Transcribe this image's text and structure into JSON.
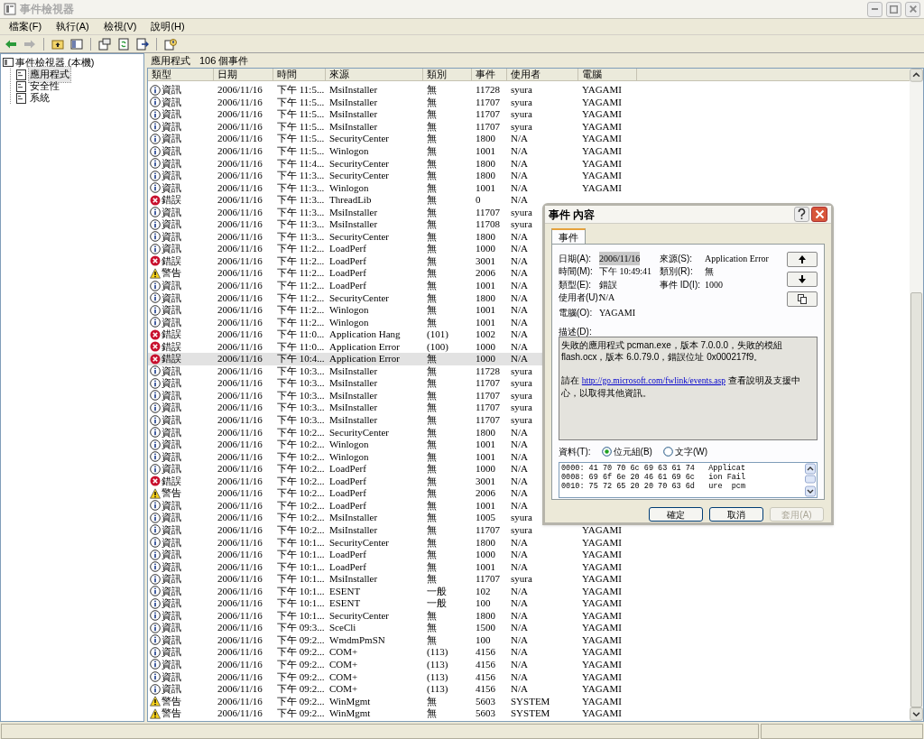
{
  "window": {
    "title": "事件檢視器"
  },
  "menu": [
    "檔案(F)",
    "執行(A)",
    "檢視(V)",
    "說明(H)"
  ],
  "tree": {
    "root": "事件檢視器 (本機)",
    "children": [
      {
        "label": "應用程式",
        "selected": true
      },
      {
        "label": "安全性",
        "selected": false
      },
      {
        "label": "系統",
        "selected": false
      }
    ]
  },
  "list": {
    "title": "應用程式",
    "count": "106 個事件",
    "columns": [
      "類型",
      "日期",
      "時間",
      "來源",
      "類別",
      "事件",
      "使用者",
      "電腦"
    ],
    "rows": [
      {
        "kind": "info",
        "type": "資訊",
        "date": "2006/11/16",
        "time": "下午 11:5...",
        "source": "MsiInstaller",
        "category": "無",
        "event": "11728",
        "user": "syura",
        "computer": "YAGAMI",
        "selected": false
      },
      {
        "kind": "info",
        "type": "資訊",
        "date": "2006/11/16",
        "time": "下午 11:5...",
        "source": "MsiInstaller",
        "category": "無",
        "event": "11707",
        "user": "syura",
        "computer": "YAGAMI",
        "selected": false
      },
      {
        "kind": "info",
        "type": "資訊",
        "date": "2006/11/16",
        "time": "下午 11:5...",
        "source": "MsiInstaller",
        "category": "無",
        "event": "11707",
        "user": "syura",
        "computer": "YAGAMI",
        "selected": false
      },
      {
        "kind": "info",
        "type": "資訊",
        "date": "2006/11/16",
        "time": "下午 11:5...",
        "source": "MsiInstaller",
        "category": "無",
        "event": "11707",
        "user": "syura",
        "computer": "YAGAMI",
        "selected": false
      },
      {
        "kind": "info",
        "type": "資訊",
        "date": "2006/11/16",
        "time": "下午 11:5...",
        "source": "SecurityCenter",
        "category": "無",
        "event": "1800",
        "user": "N/A",
        "computer": "YAGAMI",
        "selected": false
      },
      {
        "kind": "info",
        "type": "資訊",
        "date": "2006/11/16",
        "time": "下午 11:5...",
        "source": "Winlogon",
        "category": "無",
        "event": "1001",
        "user": "N/A",
        "computer": "YAGAMI",
        "selected": false
      },
      {
        "kind": "info",
        "type": "資訊",
        "date": "2006/11/16",
        "time": "下午 11:4...",
        "source": "SecurityCenter",
        "category": "無",
        "event": "1800",
        "user": "N/A",
        "computer": "YAGAMI",
        "selected": false
      },
      {
        "kind": "info",
        "type": "資訊",
        "date": "2006/11/16",
        "time": "下午 11:3...",
        "source": "SecurityCenter",
        "category": "無",
        "event": "1800",
        "user": "N/A",
        "computer": "YAGAMI",
        "selected": false
      },
      {
        "kind": "info",
        "type": "資訊",
        "date": "2006/11/16",
        "time": "下午 11:3...",
        "source": "Winlogon",
        "category": "無",
        "event": "1001",
        "user": "N/A",
        "computer": "YAGAMI",
        "selected": false
      },
      {
        "kind": "error",
        "type": "錯誤",
        "date": "2006/11/16",
        "time": "下午 11:3...",
        "source": "ThreadLib",
        "category": "無",
        "event": "0",
        "user": "N/A",
        "selected": false
      },
      {
        "kind": "info",
        "type": "資訊",
        "date": "2006/11/16",
        "time": "下午 11:3...",
        "source": "MsiInstaller",
        "category": "無",
        "event": "11707",
        "user": "syura",
        "selected": false
      },
      {
        "kind": "info",
        "type": "資訊",
        "date": "2006/11/16",
        "time": "下午 11:3...",
        "source": "MsiInstaller",
        "category": "無",
        "event": "11708",
        "user": "syura",
        "selected": false
      },
      {
        "kind": "info",
        "type": "資訊",
        "date": "2006/11/16",
        "time": "下午 11:3...",
        "source": "SecurityCenter",
        "category": "無",
        "event": "1800",
        "user": "N/A",
        "selected": false
      },
      {
        "kind": "info",
        "type": "資訊",
        "date": "2006/11/16",
        "time": "下午 11:2...",
        "source": "LoadPerf",
        "category": "無",
        "event": "1000",
        "user": "N/A",
        "selected": false
      },
      {
        "kind": "error",
        "type": "錯誤",
        "date": "2006/11/16",
        "time": "下午 11:2...",
        "source": "LoadPerf",
        "category": "無",
        "event": "3001",
        "user": "N/A",
        "selected": false
      },
      {
        "kind": "warning",
        "type": "警告",
        "date": "2006/11/16",
        "time": "下午 11:2...",
        "source": "LoadPerf",
        "category": "無",
        "event": "2006",
        "user": "N/A",
        "selected": false
      },
      {
        "kind": "info",
        "type": "資訊",
        "date": "2006/11/16",
        "time": "下午 11:2...",
        "source": "LoadPerf",
        "category": "無",
        "event": "1001",
        "user": "N/A",
        "selected": false
      },
      {
        "kind": "info",
        "type": "資訊",
        "date": "2006/11/16",
        "time": "下午 11:2...",
        "source": "SecurityCenter",
        "category": "無",
        "event": "1800",
        "user": "N/A",
        "selected": false
      },
      {
        "kind": "info",
        "type": "資訊",
        "date": "2006/11/16",
        "time": "下午 11:2...",
        "source": "Winlogon",
        "category": "無",
        "event": "1001",
        "user": "N/A",
        "selected": false
      },
      {
        "kind": "info",
        "type": "資訊",
        "date": "2006/11/16",
        "time": "下午 11:2...",
        "source": "Winlogon",
        "category": "無",
        "event": "1001",
        "user": "N/A",
        "selected": false
      },
      {
        "kind": "error",
        "type": "錯誤",
        "date": "2006/11/16",
        "time": "下午 11:0...",
        "source": "Application Hang",
        "category": "(101)",
        "event": "1002",
        "user": "N/A",
        "selected": false
      },
      {
        "kind": "error",
        "type": "錯誤",
        "date": "2006/11/16",
        "time": "下午 11:0...",
        "source": "Application Error",
        "category": "(100)",
        "event": "1000",
        "user": "N/A",
        "selected": false
      },
      {
        "kind": "error",
        "type": "錯誤",
        "date": "2006/11/16",
        "time": "下午 10:4...",
        "source": "Application Error",
        "category": "無",
        "event": "1000",
        "user": "N/A",
        "selected": true
      },
      {
        "kind": "info",
        "type": "資訊",
        "date": "2006/11/16",
        "time": "下午 10:3...",
        "source": "MsiInstaller",
        "category": "無",
        "event": "11728",
        "user": "syura",
        "selected": false
      },
      {
        "kind": "info",
        "type": "資訊",
        "date": "2006/11/16",
        "time": "下午 10:3...",
        "source": "MsiInstaller",
        "category": "無",
        "event": "11707",
        "user": "syura",
        "selected": false
      },
      {
        "kind": "info",
        "type": "資訊",
        "date": "2006/11/16",
        "time": "下午 10:3...",
        "source": "MsiInstaller",
        "category": "無",
        "event": "11707",
        "user": "syura",
        "selected": false
      },
      {
        "kind": "info",
        "type": "資訊",
        "date": "2006/11/16",
        "time": "下午 10:3...",
        "source": "MsiInstaller",
        "category": "無",
        "event": "11707",
        "user": "syura",
        "selected": false
      },
      {
        "kind": "info",
        "type": "資訊",
        "date": "2006/11/16",
        "time": "下午 10:3...",
        "source": "MsiInstaller",
        "category": "無",
        "event": "11707",
        "user": "syura",
        "selected": false
      },
      {
        "kind": "info",
        "type": "資訊",
        "date": "2006/11/16",
        "time": "下午 10:2...",
        "source": "SecurityCenter",
        "category": "無",
        "event": "1800",
        "user": "N/A",
        "selected": false
      },
      {
        "kind": "info",
        "type": "資訊",
        "date": "2006/11/16",
        "time": "下午 10:2...",
        "source": "Winlogon",
        "category": "無",
        "event": "1001",
        "user": "N/A",
        "selected": false
      },
      {
        "kind": "info",
        "type": "資訊",
        "date": "2006/11/16",
        "time": "下午 10:2...",
        "source": "Winlogon",
        "category": "無",
        "event": "1001",
        "user": "N/A",
        "selected": false
      },
      {
        "kind": "info",
        "type": "資訊",
        "date": "2006/11/16",
        "time": "下午 10:2...",
        "source": "LoadPerf",
        "category": "無",
        "event": "1000",
        "user": "N/A",
        "selected": false
      },
      {
        "kind": "error",
        "type": "錯誤",
        "date": "2006/11/16",
        "time": "下午 10:2...",
        "source": "LoadPerf",
        "category": "無",
        "event": "3001",
        "user": "N/A",
        "selected": false
      },
      {
        "kind": "warning",
        "type": "警告",
        "date": "2006/11/16",
        "time": "下午 10:2...",
        "source": "LoadPerf",
        "category": "無",
        "event": "2006",
        "user": "N/A",
        "selected": false
      },
      {
        "kind": "info",
        "type": "資訊",
        "date": "2006/11/16",
        "time": "下午 10:2...",
        "source": "LoadPerf",
        "category": "無",
        "event": "1001",
        "user": "N/A",
        "selected": false
      },
      {
        "kind": "info",
        "type": "資訊",
        "date": "2006/11/16",
        "time": "下午 10:2...",
        "source": "MsiInstaller",
        "category": "無",
        "event": "1005",
        "user": "syura",
        "selected": false
      },
      {
        "kind": "info",
        "type": "資訊",
        "date": "2006/11/16",
        "time": "下午 10:2...",
        "source": "MsiInstaller",
        "category": "無",
        "event": "11707",
        "user": "syura",
        "computer": "YAGAMI",
        "selected": false
      },
      {
        "kind": "info",
        "type": "資訊",
        "date": "2006/11/16",
        "time": "下午 10:1...",
        "source": "SecurityCenter",
        "category": "無",
        "event": "1800",
        "user": "N/A",
        "computer": "YAGAMI",
        "selected": false
      },
      {
        "kind": "info",
        "type": "資訊",
        "date": "2006/11/16",
        "time": "下午 10:1...",
        "source": "LoadPerf",
        "category": "無",
        "event": "1000",
        "user": "N/A",
        "computer": "YAGAMI",
        "selected": false
      },
      {
        "kind": "info",
        "type": "資訊",
        "date": "2006/11/16",
        "time": "下午 10:1...",
        "source": "LoadPerf",
        "category": "無",
        "event": "1001",
        "user": "N/A",
        "computer": "YAGAMI",
        "selected": false
      },
      {
        "kind": "info",
        "type": "資訊",
        "date": "2006/11/16",
        "time": "下午 10:1...",
        "source": "MsiInstaller",
        "category": "無",
        "event": "11707",
        "user": "syura",
        "computer": "YAGAMI",
        "selected": false
      },
      {
        "kind": "info",
        "type": "資訊",
        "date": "2006/11/16",
        "time": "下午 10:1...",
        "source": "ESENT",
        "category": "一般",
        "event": "102",
        "user": "N/A",
        "computer": "YAGAMI",
        "selected": false
      },
      {
        "kind": "info",
        "type": "資訊",
        "date": "2006/11/16",
        "time": "下午 10:1...",
        "source": "ESENT",
        "category": "一般",
        "event": "100",
        "user": "N/A",
        "computer": "YAGAMI",
        "selected": false
      },
      {
        "kind": "info",
        "type": "資訊",
        "date": "2006/11/16",
        "time": "下午 10:1...",
        "source": "SecurityCenter",
        "category": "無",
        "event": "1800",
        "user": "N/A",
        "computer": "YAGAMI",
        "selected": false
      },
      {
        "kind": "info",
        "type": "資訊",
        "date": "2006/11/16",
        "time": "下午 09:3...",
        "source": "SceCli",
        "category": "無",
        "event": "1500",
        "user": "N/A",
        "computer": "YAGAMI",
        "selected": false
      },
      {
        "kind": "info",
        "type": "資訊",
        "date": "2006/11/16",
        "time": "下午 09:2...",
        "source": "WmdmPmSN",
        "category": "無",
        "event": "100",
        "user": "N/A",
        "computer": "YAGAMI",
        "selected": false
      },
      {
        "kind": "info",
        "type": "資訊",
        "date": "2006/11/16",
        "time": "下午 09:2...",
        "source": "COM+",
        "category": "(113)",
        "event": "4156",
        "user": "N/A",
        "computer": "YAGAMI",
        "selected": false
      },
      {
        "kind": "info",
        "type": "資訊",
        "date": "2006/11/16",
        "time": "下午 09:2...",
        "source": "COM+",
        "category": "(113)",
        "event": "4156",
        "user": "N/A",
        "computer": "YAGAMI",
        "selected": false
      },
      {
        "kind": "info",
        "type": "資訊",
        "date": "2006/11/16",
        "time": "下午 09:2...",
        "source": "COM+",
        "category": "(113)",
        "event": "4156",
        "user": "N/A",
        "computer": "YAGAMI",
        "selected": false
      },
      {
        "kind": "info",
        "type": "資訊",
        "date": "2006/11/16",
        "time": "下午 09:2...",
        "source": "COM+",
        "category": "(113)",
        "event": "4156",
        "user": "N/A",
        "computer": "YAGAMI",
        "selected": false
      },
      {
        "kind": "warning",
        "type": "警告",
        "date": "2006/11/16",
        "time": "下午 09:2...",
        "source": "WinMgmt",
        "category": "無",
        "event": "5603",
        "user": "SYSTEM",
        "computer": "YAGAMI",
        "selected": false
      },
      {
        "kind": "warning",
        "type": "警告",
        "date": "2006/11/16",
        "time": "下午 09:2...",
        "source": "WinMgmt",
        "category": "無",
        "event": "5603",
        "user": "SYSTEM",
        "computer": "YAGAMI",
        "selected": false
      }
    ]
  },
  "dialog": {
    "title": "事件 內容",
    "tab": "事件",
    "fields_left": [
      {
        "label": "日期(A):",
        "value": "2006/11/16",
        "highlighted": true
      },
      {
        "label": "時間(M):",
        "value": "下午 10:49:41",
        "highlighted": false
      },
      {
        "label": "類型(E):",
        "value": "錯誤",
        "highlighted": false
      },
      {
        "label": "使用者(U):",
        "value": "N/A",
        "highlighted": false
      },
      {
        "label": "電腦(O):",
        "value": "YAGAMI",
        "highlighted": false
      }
    ],
    "fields_right": [
      {
        "label": "來源(S):",
        "value": "Application Error",
        "highlighted": false
      },
      {
        "label": "類別(R):",
        "value": "無",
        "highlighted": false
      },
      {
        "label": "事件 ID(I):",
        "value": "1000",
        "highlighted": false
      }
    ],
    "description_label": "描述(D):",
    "description": "失敗的應用程式 pcman.exe，版本 7.0.0.0，失敗的模組 flash.ocx，版本 6.0.79.0，錯誤位址 0x000217f9。",
    "help_before": "請在 ",
    "help_link": "http://go.microsoft.com/fwlink/events.asp",
    "help_after": " 查看說明及支援中心，以取得其他資訊。",
    "data_label": "資料(T):",
    "formats": [
      {
        "label": "位元組(B)",
        "selected": true
      },
      {
        "label": "文字(W)",
        "selected": false
      }
    ],
    "data_lines": [
      "0000: 41 70 70 6c 69 63 61 74   Applicat",
      "0008: 69 6f 6e 20 46 61 69 6c   ion Fail",
      "0010: 75 72 65 20 20 70 63 6d   ure  pcm"
    ],
    "buttons": [
      {
        "label": "確定",
        "disabled": false
      },
      {
        "label": "取消",
        "disabled": false
      },
      {
        "label": "套用(A)",
        "disabled": true
      }
    ]
  }
}
